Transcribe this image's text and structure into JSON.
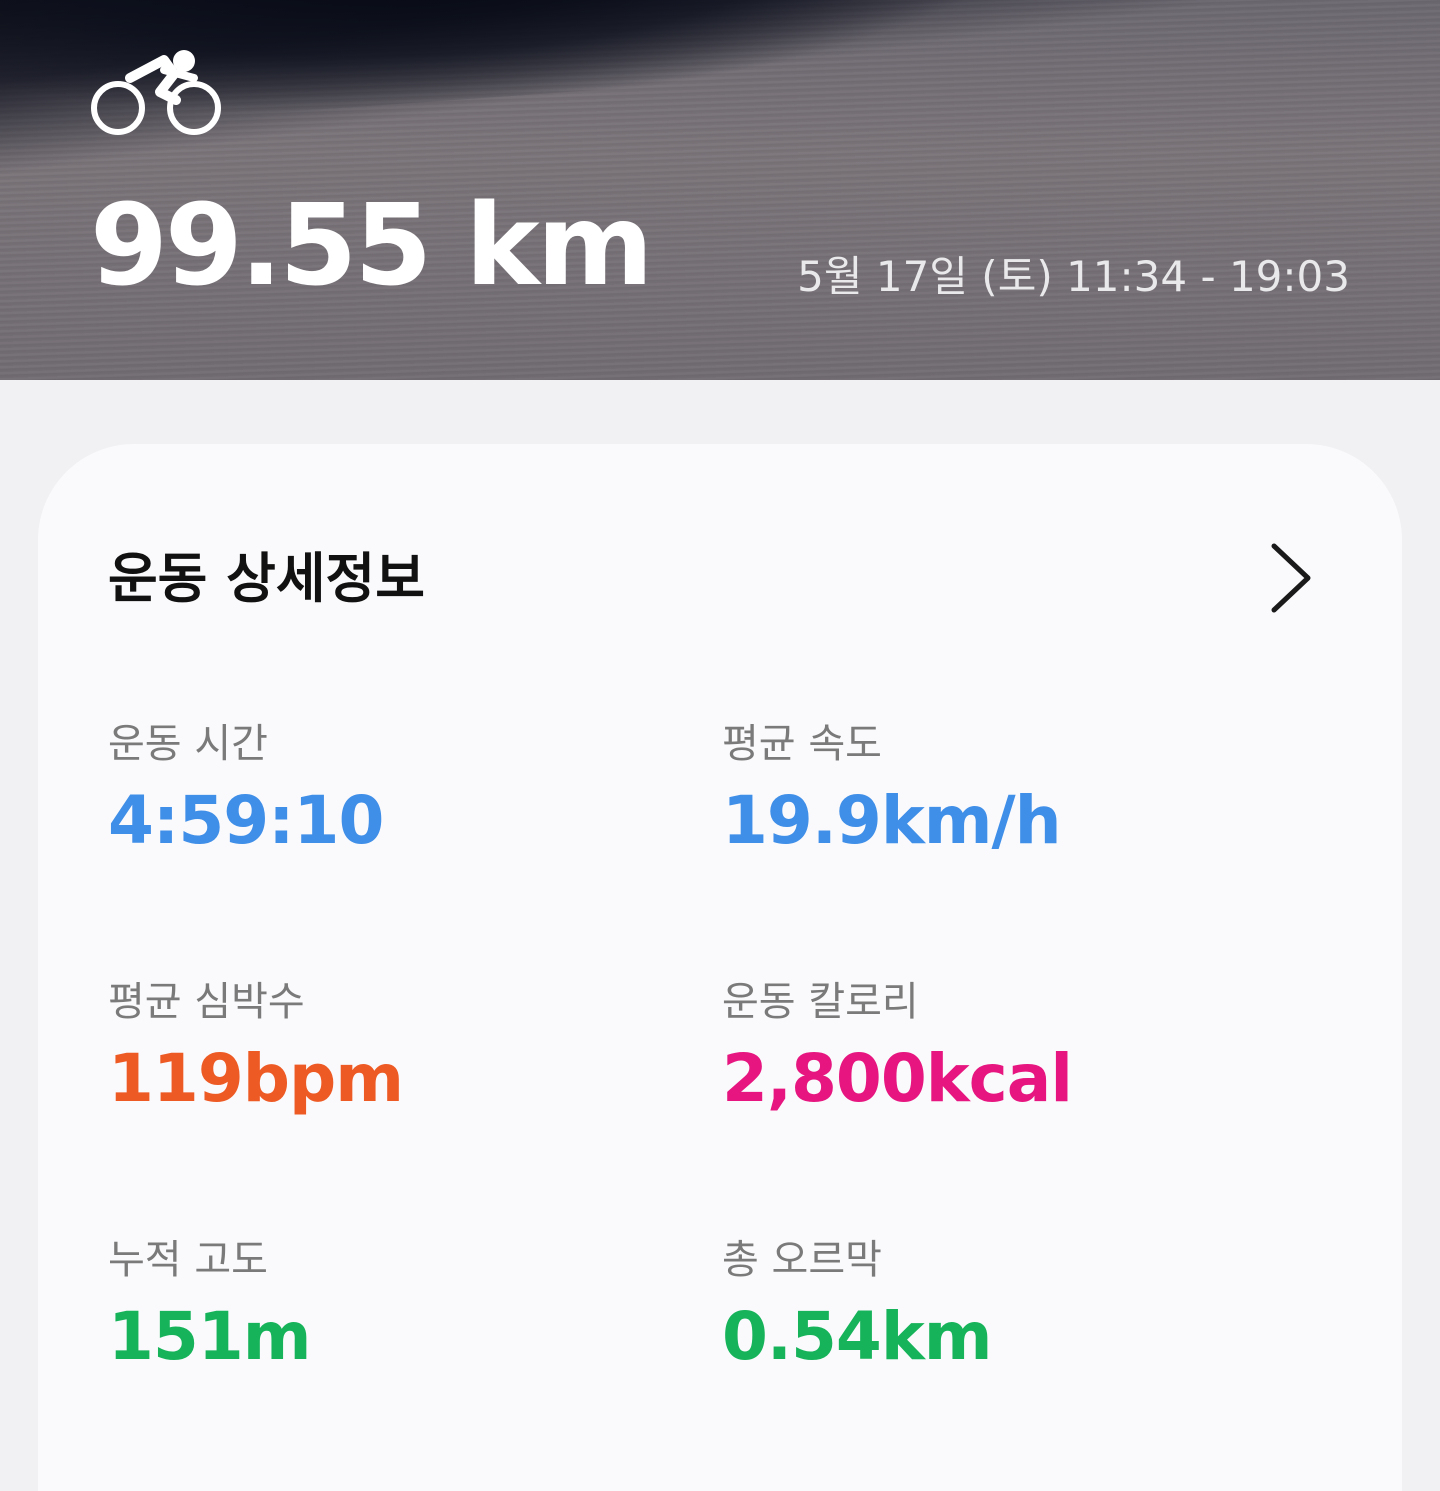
{
  "header": {
    "activity_icon": "cycling-icon",
    "distance": "99.55 km",
    "datetime": "5월 17일 (토) 11:34 - 19:03"
  },
  "details": {
    "title": "운동 상세정보",
    "chevron_icon": "chevron-right-icon",
    "stats": [
      {
        "label": "운동 시간",
        "value": "4:59:10",
        "color": "#3f8ee8"
      },
      {
        "label": "평균 속도",
        "value": "19.9km/h",
        "color": "#3f8ee8"
      },
      {
        "label": "평균 심박수",
        "value": "119bpm",
        "color": "#ee5a24"
      },
      {
        "label": "운동 칼로리",
        "value": "2,800kcal",
        "color": "#e6157f"
      },
      {
        "label": "누적 고도",
        "value": "151m",
        "color": "#16b35a"
      },
      {
        "label": "총 오르막",
        "value": "0.54km",
        "color": "#16b35a"
      }
    ]
  }
}
